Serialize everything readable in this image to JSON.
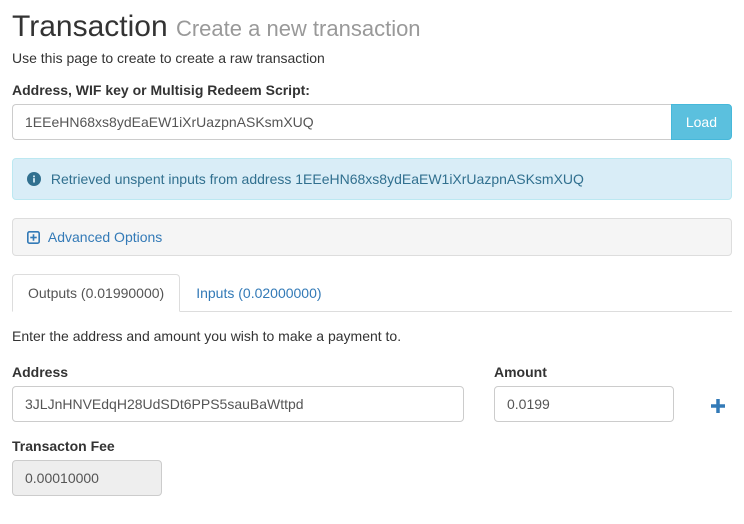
{
  "header": {
    "title": "Transaction",
    "subtitle": "Create a new transaction",
    "description": "Use this page to create to create a raw transaction"
  },
  "redeemScript": {
    "label": "Address, WIF key or Multisig Redeem Script",
    "value": "1EEeHN68xs8ydEaEW1iXrUazpnASKsmXUQ",
    "loadButton": "Load"
  },
  "alert": {
    "text": "Retrieved unspent inputs from address 1EEeHN68xs8ydEaEW1iXrUazpnASKsmXUQ"
  },
  "advanced": {
    "label": "Advanced Options"
  },
  "tabs": {
    "outputs": "Outputs (0.01990000)",
    "inputs": "Inputs (0.02000000)"
  },
  "outputsPane": {
    "helpText": "Enter the address and amount you wish to make a payment to.",
    "addressLabel": "Address",
    "amountLabel": "Amount",
    "rows": [
      {
        "address": "3JLJnHNVEdqH28UdSDt6PPS5sauBaWttpd",
        "amount": "0.0199"
      }
    ],
    "feeLabel": "Transacton Fee",
    "feeValue": "0.00010000"
  }
}
